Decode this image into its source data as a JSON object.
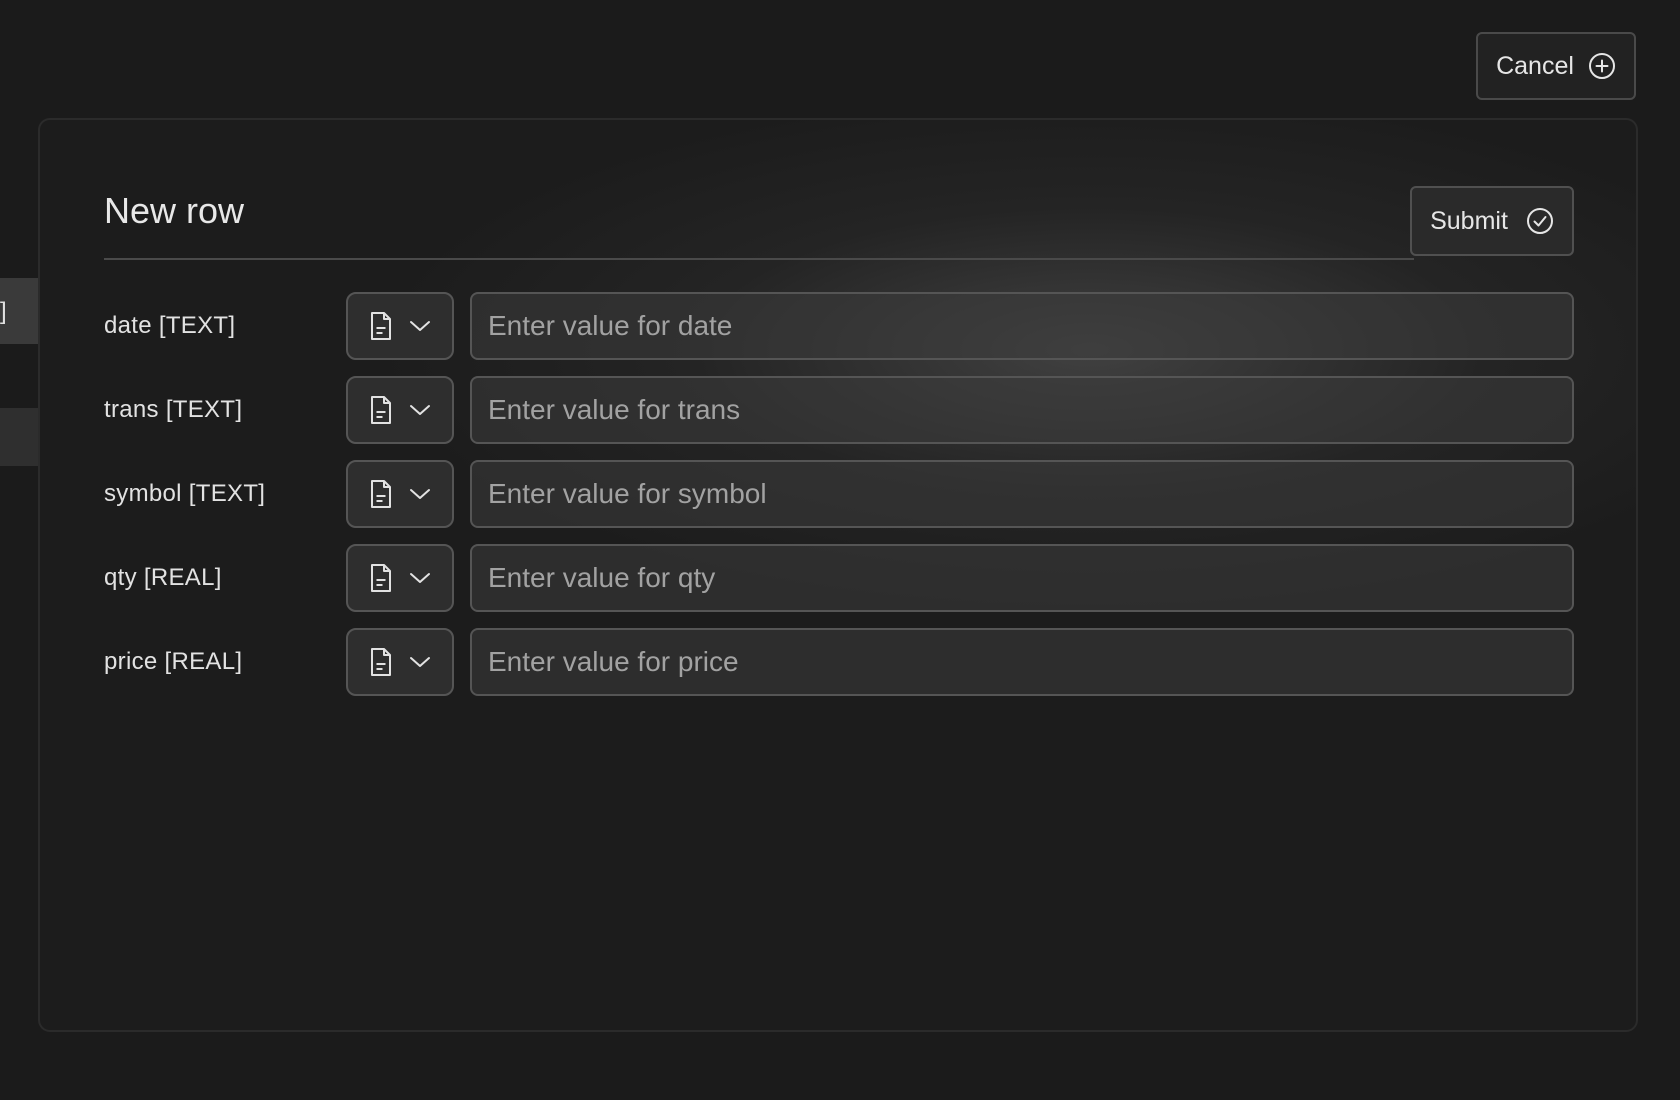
{
  "header": {
    "cancel_label": "Cancel",
    "cancel_icon": "plus-circle-icon"
  },
  "background": {
    "left_fragment_text": "]"
  },
  "modal": {
    "title": "New row",
    "submit_label": "Submit",
    "submit_icon": "check-circle-icon",
    "fields": [
      {
        "label": "date [TEXT]",
        "placeholder": "Enter value for date",
        "value": "",
        "type_icon": "file-text-icon"
      },
      {
        "label": "trans [TEXT]",
        "placeholder": "Enter value for trans",
        "value": "",
        "type_icon": "file-text-icon"
      },
      {
        "label": "symbol [TEXT]",
        "placeholder": "Enter value for symbol",
        "value": "",
        "type_icon": "file-text-icon"
      },
      {
        "label": "qty [REAL]",
        "placeholder": "Enter value for qty",
        "value": "",
        "type_icon": "file-text-icon"
      },
      {
        "label": "price [REAL]",
        "placeholder": "Enter value for price",
        "value": "",
        "type_icon": "file-text-icon"
      }
    ]
  },
  "colors": {
    "background": "#1b1b1b",
    "text": "#e4e4e4",
    "placeholder": "#a2a2a2",
    "border": "#555555"
  }
}
